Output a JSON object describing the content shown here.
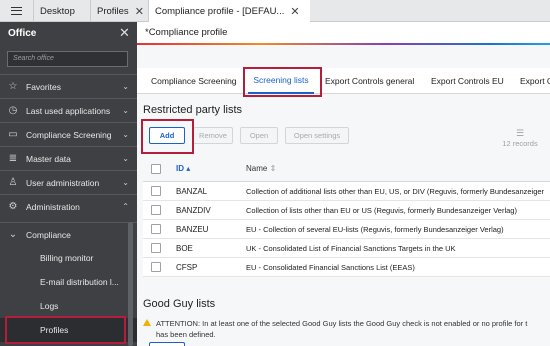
{
  "tabs": [
    {
      "label": "Desktop"
    },
    {
      "label": "Profiles"
    },
    {
      "label": "Compliance profile - [DEFAU..."
    }
  ],
  "sidebar": {
    "title": "Office",
    "search_placeholder": "Search office",
    "items": [
      {
        "label": "Favorites",
        "icon": "star-icon"
      },
      {
        "label": "Last used applications",
        "icon": "clock-icon"
      },
      {
        "label": "Compliance Screening",
        "icon": "id-card-icon"
      },
      {
        "label": "Master data",
        "icon": "database-icon"
      },
      {
        "label": "User administration",
        "icon": "user-icon"
      },
      {
        "label": "Administration",
        "icon": "gear-icon"
      }
    ],
    "compliance_group": "Compliance",
    "sub_items": [
      {
        "label": "Billing monitor"
      },
      {
        "label": "E-mail distribution l..."
      },
      {
        "label": "Logs"
      },
      {
        "label": "Profiles"
      }
    ]
  },
  "main": {
    "profile_title": "*Compliance profile",
    "subtabs": [
      {
        "label": "Compliance Screening"
      },
      {
        "label": "Screening lists"
      },
      {
        "label": "Export Controls general"
      },
      {
        "label": "Export Controls EU"
      },
      {
        "label": "Export C"
      }
    ],
    "restricted_title": "Restricted party lists",
    "toolbar": {
      "add": "Add",
      "remove": "Remove",
      "open": "Open",
      "open_settings": "Open settings",
      "records": "12 records"
    },
    "columns": {
      "id": "ID",
      "name": "Name"
    },
    "rows": [
      {
        "id": "BANZAL",
        "name": "Collection of additional lists other than EU, US, or DIV (Reguvis, formerly Bundesanzeiger"
      },
      {
        "id": "BANZDIV",
        "name": "Collection of lists other than EU or US (Reguvis, formerly Bundesanzeiger Verlag)"
      },
      {
        "id": "BANZEU",
        "name": "EU - Collection of several EU-lists (Reguvis, formerly Bundesanzeiger Verlag)"
      },
      {
        "id": "BOE",
        "name": "UK - Consolidated List of Financial Sanctions Targets in the UK"
      },
      {
        "id": "CFSP",
        "name": "EU - Consolidated Financial Sanctions List (EEAS)"
      }
    ],
    "good_guy_title": "Good Guy lists",
    "warning_line1": "ATTENTION: In at least one of the selected Good Guy lists the Good Guy check is not enabled or no profile for t",
    "warning_line2": "has been defined."
  },
  "colors": {
    "accent": "#1a62c9",
    "highlight": "#b51d3a",
    "sidebar_bg": "#3e4043",
    "warning": "#f2b100"
  }
}
